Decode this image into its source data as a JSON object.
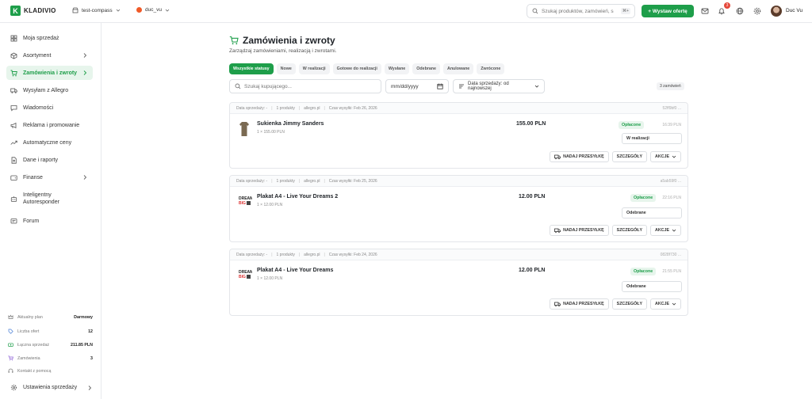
{
  "app": {
    "logo_letter": "K",
    "logo_text": "KLADIVIO"
  },
  "topbar": {
    "workspace": "test-compass",
    "account": "duc_vu",
    "search_placeholder": "Szukaj produktów, zamówień, s",
    "search_shortcut": "⌘+",
    "add_offer_label": "+ Wystaw ofertę",
    "notif_count": "3",
    "user_name": "Duc Vu"
  },
  "sidebar": {
    "items": [
      {
        "label": "Moja sprzedaż",
        "icon": "grid-icon"
      },
      {
        "label": "Asortyment",
        "icon": "box-icon",
        "chevron": true
      },
      {
        "label": "Zamówienia i zwroty",
        "icon": "cart-icon",
        "chevron": true,
        "active": true
      },
      {
        "label": "Wysyłam z Allegro",
        "icon": "truck-icon"
      },
      {
        "label": "Wiadomości",
        "icon": "message-icon"
      },
      {
        "label": "Reklama i promowanie",
        "icon": "megaphone-icon"
      },
      {
        "label": "Automatyczne ceny",
        "icon": "trend-icon"
      },
      {
        "label": "Dane i raporty",
        "icon": "document-icon"
      },
      {
        "label": "Finanse",
        "icon": "wallet-icon",
        "chevron": true
      },
      {
        "label": "Inteligentny Autoresponder",
        "icon": "bot-icon"
      },
      {
        "label": "Forum",
        "icon": "forum-icon"
      }
    ],
    "stats": [
      {
        "label": "Aktualny plan",
        "value": "Darmowy"
      },
      {
        "label": "Liczba ofert",
        "value": "12"
      },
      {
        "label": "Łączna sprzedaż",
        "value": "211.85 PLN"
      },
      {
        "label": "Zamówienia",
        "value": "3"
      },
      {
        "label": "Kontakt z pomocą",
        "value": ""
      }
    ],
    "settings_label": "Ustawienia sprzedaży"
  },
  "main": {
    "title": "Zamówienia i zwroty",
    "subtitle": "Zarządzaj zamówieniami, realizacją i zwrotami.",
    "tabs": [
      "Wszystkie statusy",
      "Nowe",
      "W realizacji",
      "Gotowe do realizacji",
      "Wysłane",
      "Odebrane",
      "Anulowane",
      "Zwrócone"
    ],
    "search_placeholder": "Szukaj kupującego...",
    "date_placeholder": "mm/dd/yyyy",
    "sort_label": "Data sprzedaży: od najnowszej",
    "order_count": "3 zamówień"
  },
  "orders": [
    {
      "sale_date": "Data sprzedaży: -",
      "products_count": "1 produkty",
      "marketplace": "allegro.pl",
      "ship_time": "Czas wysyłki: Feb 26, 2026",
      "order_id": "52ff9bf0 ...",
      "product_name": "Sukienka Jimmy Sanders",
      "qty_line": "1 × 155.00 PLN",
      "price": "155.00 PLN",
      "payment_status": "Opłacone",
      "time": "16:39 PLN",
      "status": "W realizacji",
      "thumb": "dress"
    },
    {
      "sale_date": "Data sprzedaży: -",
      "products_count": "1 produkty",
      "marketplace": "allegro.pl",
      "ship_time": "Czas wysyłki: Feb 25, 2026",
      "order_id": "a5ab59f0 ...",
      "product_name": "Plakat A4 - Live Your Dreams 2",
      "qty_line": "1 × 12.00 PLN",
      "price": "12.00 PLN",
      "payment_status": "Opłacone",
      "time": "22:16 PLN",
      "status": "Odebrane",
      "thumb": "poster"
    },
    {
      "sale_date": "Data sprzedaży: -",
      "products_count": "1 produkty",
      "marketplace": "allegro.pl",
      "ship_time": "Czas wysyłki: Feb 24, 2026",
      "order_id": "0828f730 ...",
      "product_name": "Plakat A4 - Live Your Dreams",
      "qty_line": "1 × 12.00 PLN",
      "price": "12.00 PLN",
      "payment_status": "Opłacone",
      "time": "21:55 PLN",
      "status": "Odebrane",
      "thumb": "poster"
    }
  ],
  "order_actions": {
    "ship": "NADAJ PRZESYŁKĘ",
    "details": "SZCZEGÓŁY",
    "actions": "AKCJE"
  },
  "colors": {
    "accent": "#1e9e4a",
    "accent_bg": "#e7f5ec",
    "badge": "#e5483b"
  }
}
